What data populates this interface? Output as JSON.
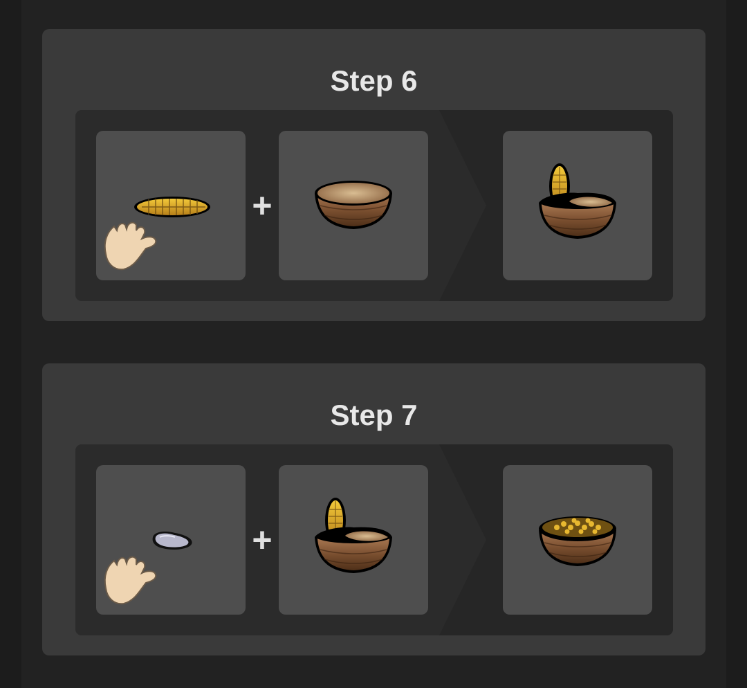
{
  "steps": [
    {
      "title": "Step 6",
      "plus": "+",
      "ingredients": [
        {
          "icon": "corn-cob-icon",
          "modifier_icon": "hand-icon"
        },
        {
          "icon": "empty-basket-icon"
        }
      ],
      "result": {
        "icon": "basket-with-corn-icon"
      }
    },
    {
      "title": "Step 7",
      "plus": "+",
      "ingredients": [
        {
          "icon": "stone-icon",
          "modifier_icon": "hand-icon"
        },
        {
          "icon": "basket-with-corn-icon"
        }
      ],
      "result": {
        "icon": "basket-of-corn-kernels-icon"
      }
    }
  ],
  "colors": {
    "page_background": "#1c1c1c",
    "column_background": "#222222",
    "card_background": "#3a3a3a",
    "row_background": "#2b2b2b",
    "slot_background": "#4e4e4e",
    "title_text": "#e8e8e8"
  }
}
